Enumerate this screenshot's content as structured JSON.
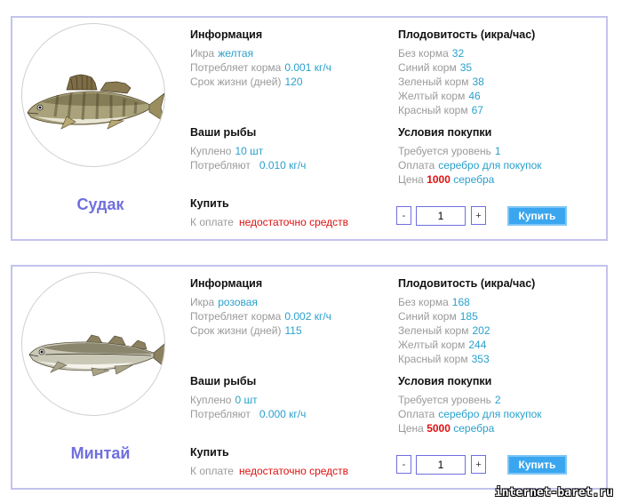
{
  "labels": {
    "info": "Информация",
    "roe": "Икра",
    "feed": "Потребляет корма",
    "life": "Срок жизни (дней)",
    "fertility": "Плодовитость (икра/час)",
    "no_feed": "Без корма",
    "blue_feed": "Синий корм",
    "green_feed": "Зеленый корм",
    "yellow_feed": "Желтый корм",
    "red_feed": "Красный корм",
    "your_fish": "Ваши рыбы",
    "bought": "Куплено",
    "consume": "Потребляют",
    "conditions": "Условия покупки",
    "level": "Требуется уровень",
    "payment": "Оплата",
    "price": "Цена",
    "buy": "Купить",
    "to_pay": "К оплате"
  },
  "fish": [
    {
      "name": "Судак",
      "roe": "желтая",
      "feed": "0.001 кг/ч",
      "life": "120",
      "no_feed": "32",
      "blue_feed": "35",
      "green_feed": "38",
      "yellow_feed": "46",
      "red_feed": "67",
      "bought": "10 шт",
      "consume": "0.010 кг/ч",
      "level": "1",
      "payment": "серебро для покупок",
      "price": "1000",
      "currency": "серебра",
      "to_pay": "недостаточно средств",
      "qty": "1",
      "minus": "-",
      "plus": "+",
      "buy_button": "Купить"
    },
    {
      "name": "Минтай",
      "roe": "розовая",
      "feed": "0.002 кг/ч",
      "life": "115",
      "no_feed": "168",
      "blue_feed": "185",
      "green_feed": "202",
      "yellow_feed": "244",
      "red_feed": "353",
      "bought": "0 шт",
      "consume": "0.000 кг/ч",
      "level": "2",
      "payment": "серебро для покупок",
      "price": "5000",
      "currency": "серебра",
      "to_pay": "недостаточно средств",
      "qty": "1",
      "minus": "-",
      "plus": "+",
      "buy_button": "Купить"
    }
  ],
  "watermark": "internet-baret.ru"
}
